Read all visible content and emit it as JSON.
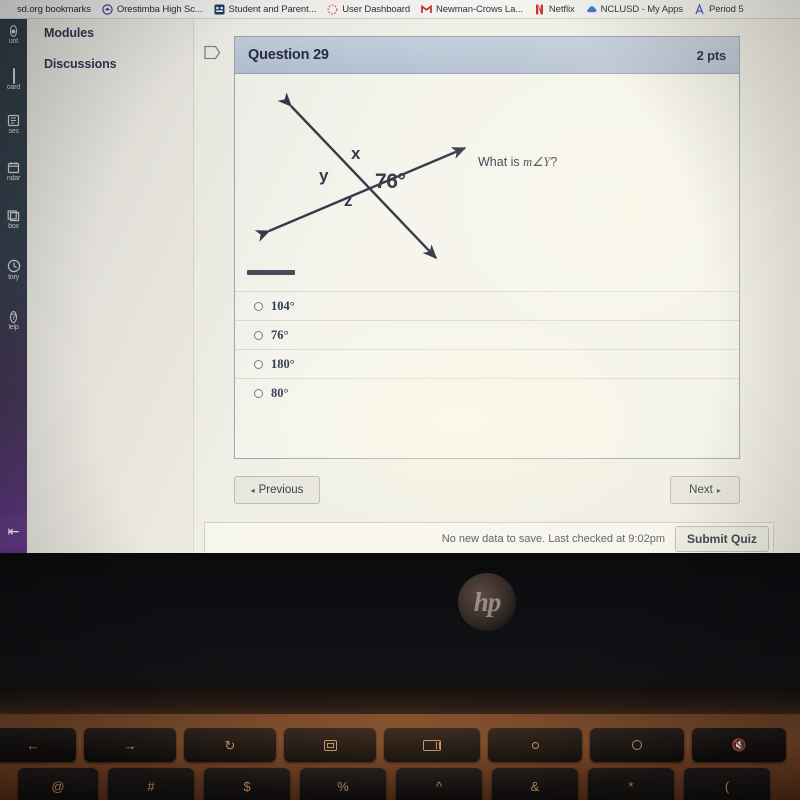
{
  "browser": {
    "bookmarks": [
      {
        "label": "sd.org bookmarks",
        "icon": "folder-icon"
      },
      {
        "label": "Orestimba High Sc...",
        "icon": "circle-logo-icon"
      },
      {
        "label": "Student and Parent...",
        "icon": "app-tile-icon"
      },
      {
        "label": "User Dashboard",
        "icon": "dotted-circle-icon"
      },
      {
        "label": "Newman-Crows La...",
        "icon": "gmail-m-icon"
      },
      {
        "label": "Netflix",
        "icon": "netflix-n-icon"
      },
      {
        "label": "NCLUSD - My Apps",
        "icon": "cloud-icon"
      },
      {
        "label": "Period 5",
        "icon": "letter-a-icon"
      }
    ]
  },
  "global_nav": {
    "items": [
      {
        "label": "unt",
        "icon": "account-icon"
      },
      {
        "label": "oard",
        "icon": "dashboard-icon"
      },
      {
        "label": "ses",
        "icon": "courses-icon"
      },
      {
        "label": "ndar",
        "icon": "calendar-icon"
      },
      {
        "label": "box",
        "icon": "inbox-icon"
      },
      {
        "label": "tory",
        "icon": "history-icon"
      },
      {
        "label": "lelp",
        "icon": "help-icon"
      }
    ],
    "collapse_icon": "collapse-left-icon"
  },
  "course_nav": {
    "items": [
      {
        "label": "Modules"
      },
      {
        "label": "Discussions"
      }
    ]
  },
  "question": {
    "flag_icon": "flag-outline-icon",
    "name": "Question 29",
    "points": "2 pts",
    "prompt_prefix": "What is ",
    "prompt_math": "m∠Y",
    "prompt_suffix": "?",
    "diagram": {
      "labels": {
        "x": "x",
        "y": "y",
        "z": "z",
        "angle": "76°"
      }
    },
    "answers": [
      {
        "text": "104°",
        "selected": false
      },
      {
        "text": "76°",
        "selected": false
      },
      {
        "text": "180°",
        "selected": false
      },
      {
        "text": "80°",
        "selected": false
      }
    ]
  },
  "navigation": {
    "previous_label": "Previous",
    "previous_arrow": "◂",
    "next_label": "Next",
    "next_arrow": "▸"
  },
  "save_bar": {
    "status": "No new data to save. Last checked at 9:02pm",
    "submit_label": "Submit Quiz"
  },
  "hardware": {
    "brand": "hp",
    "function_keys": [
      {
        "name": "back-key",
        "glyph": "←"
      },
      {
        "name": "forward-key",
        "glyph": "→"
      },
      {
        "name": "reload-key",
        "glyph": "↻"
      },
      {
        "name": "fullscreen-key",
        "glyph": ""
      },
      {
        "name": "overview-key",
        "glyph": ""
      },
      {
        "name": "brightness-down-key",
        "glyph": ""
      },
      {
        "name": "brightness-up-key",
        "glyph": ""
      },
      {
        "name": "mute-key",
        "glyph": "🔇"
      }
    ],
    "number_row_keys": [
      {
        "name": "key-at",
        "glyph": "@"
      },
      {
        "name": "key-hash",
        "glyph": "#"
      },
      {
        "name": "key-dollar",
        "glyph": "$"
      },
      {
        "name": "key-percent",
        "glyph": "%"
      },
      {
        "name": "key-caret",
        "glyph": "^"
      },
      {
        "name": "key-ampersand",
        "glyph": "&"
      },
      {
        "name": "key-asterisk",
        "glyph": "*"
      },
      {
        "name": "key-paren-open",
        "glyph": "("
      }
    ]
  },
  "colors": {
    "header_band": "#b3c0d2",
    "global_nav_top": "#2d3b45",
    "global_nav_bottom": "#5b2d82",
    "diagram_stroke": "#2b3043"
  }
}
